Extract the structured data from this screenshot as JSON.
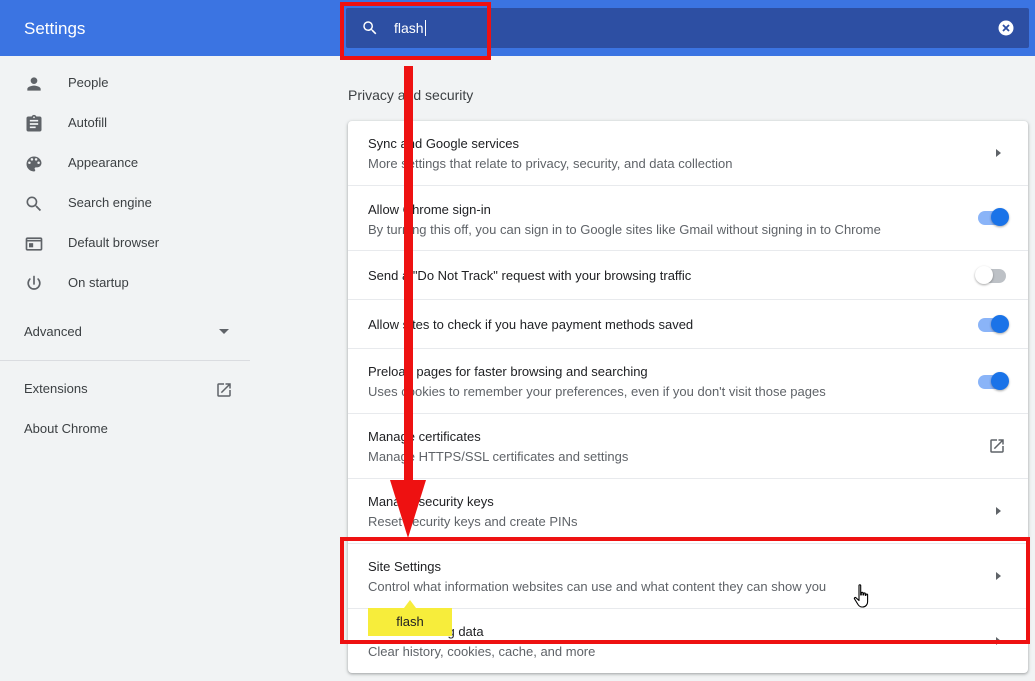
{
  "header": {
    "title": "Settings",
    "search_value": "flash",
    "search_icon": "search-icon",
    "clear_icon": "clear-search-icon",
    "color": "#3b74e2"
  },
  "sidebar": {
    "items": [
      {
        "label": "People",
        "icon": "person-icon"
      },
      {
        "label": "Autofill",
        "icon": "clipboard-icon"
      },
      {
        "label": "Appearance",
        "icon": "palette-icon"
      },
      {
        "label": "Search engine",
        "icon": "search-icon"
      },
      {
        "label": "Default browser",
        "icon": "browser-icon"
      },
      {
        "label": "On startup",
        "icon": "power-icon"
      }
    ],
    "advanced_label": "Advanced",
    "extensions_label": "Extensions",
    "about_label": "About Chrome"
  },
  "main": {
    "section_title": "Privacy and security",
    "rows": [
      {
        "title": "Sync and Google services",
        "subtitle": "More settings that relate to privacy, security, and data collection",
        "control": "arrow"
      },
      {
        "title": "Allow Chrome sign-in",
        "subtitle": "By turning this off, you can sign in to Google sites like Gmail without signing in to Chrome",
        "control": "toggle",
        "checked": true
      },
      {
        "title": "Send a \"Do Not Track\" request with your browsing traffic",
        "subtitle": "",
        "control": "toggle",
        "checked": false
      },
      {
        "title": "Allow sites to check if you have payment methods saved",
        "subtitle": "",
        "control": "toggle",
        "checked": true
      },
      {
        "title": "Preload pages for faster browsing and searching",
        "subtitle": "Uses cookies to remember your preferences, even if you don't visit those pages",
        "control": "toggle",
        "checked": true
      },
      {
        "title": "Manage certificates",
        "subtitle": "Manage HTTPS/SSL certificates and settings",
        "control": "external-link"
      },
      {
        "title": "Manage security keys",
        "subtitle": "Reset security keys and create PINs",
        "control": "arrow"
      },
      {
        "title": "Site Settings",
        "subtitle": "Control what information websites can use and what content they can show you",
        "control": "arrow"
      },
      {
        "title": "Clear browsing data",
        "subtitle": "Clear history, cookies, cache, and more",
        "control": "arrow"
      }
    ]
  },
  "overlay": {
    "search_match_tag": "flash",
    "highlight_color": "#ee1111",
    "tag_color": "#f7ed3b"
  }
}
